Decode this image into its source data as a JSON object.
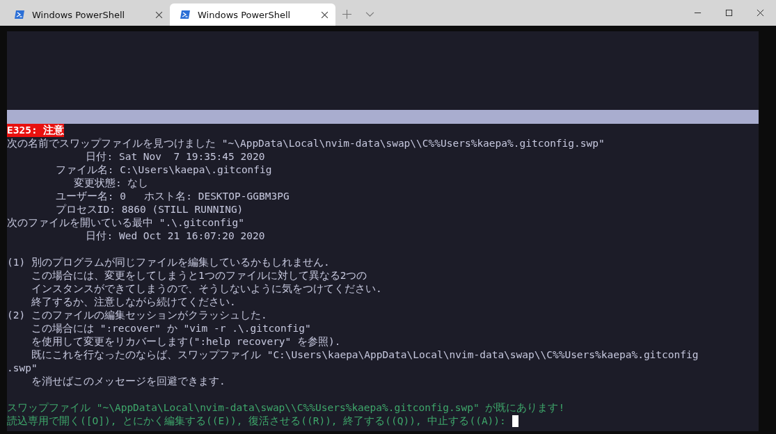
{
  "tabs": [
    {
      "title": "Windows PowerShell",
      "selected": false
    },
    {
      "title": "Windows PowerShell",
      "selected": true
    }
  ],
  "terminal": {
    "lines": [
      {
        "kind": "error",
        "text": "E325: 注意"
      },
      {
        "kind": "normal",
        "text": "次の名前でスワップファイルを見つけました \"~\\AppData\\Local\\nvim-data\\swap\\\\C%%Users%kaepa%.gitconfig.swp\""
      },
      {
        "kind": "normal",
        "text": "             日付: Sat Nov  7 19:35:45 2020"
      },
      {
        "kind": "normal",
        "text": "        ファイル名: C:\\Users\\kaepa\\.gitconfig"
      },
      {
        "kind": "normal",
        "text": "           変更状態: なし"
      },
      {
        "kind": "normal",
        "text": "        ユーザー名: 0   ホスト名: DESKTOP-GGBM3PG"
      },
      {
        "kind": "normal",
        "text": "        プロセスID: 8860 (STILL RUNNING)"
      },
      {
        "kind": "normal",
        "text": "次のファイルを開いている最中 \".\\.gitconfig\""
      },
      {
        "kind": "normal",
        "text": "             日付: Wed Oct 21 16:07:20 2020"
      },
      {
        "kind": "blank"
      },
      {
        "kind": "normal",
        "text": "(1) 別のプログラムが同じファイルを編集しているかもしれません."
      },
      {
        "kind": "normal",
        "text": "    この場合には、変更をしてしまうと1つのファイルに対して異なる2つの"
      },
      {
        "kind": "normal",
        "text": "    インスタンスができてしまうので、そうしないように気をつけてください."
      },
      {
        "kind": "normal",
        "text": "    終了するか、注意しながら続けてください."
      },
      {
        "kind": "normal",
        "text": "(2) このファイルの編集セッションがクラッシュした."
      },
      {
        "kind": "normal",
        "text": "    この場合には \":recover\" か \"vim -r .\\.gitconfig\""
      },
      {
        "kind": "normal",
        "text": "    を使用して変更をリカバーします(\":help recovery\" を参照)."
      },
      {
        "kind": "normal",
        "text": "    既にこれを行なったのならば、スワップファイル \"C:\\Users\\kaepa\\AppData\\Local\\nvim-data\\swap\\\\C%%Users%kaepa%.gitconfig"
      },
      {
        "kind": "normal",
        "text": ".swp\""
      },
      {
        "kind": "normal",
        "text": "    を消せばこのメッセージを回避できます."
      },
      {
        "kind": "blank"
      },
      {
        "kind": "prompt",
        "text": "スワップファイル \"~\\AppData\\Local\\nvim-data\\swap\\\\C%%Users%kaepa%.gitconfig.swp\" が既にあります!"
      },
      {
        "kind": "prompt",
        "text": "読込専用で開く([O]), とにかく編集する((E)), 復活させる((R)), 終了する((Q)), 中止する((A)):",
        "cursor": true
      }
    ]
  }
}
